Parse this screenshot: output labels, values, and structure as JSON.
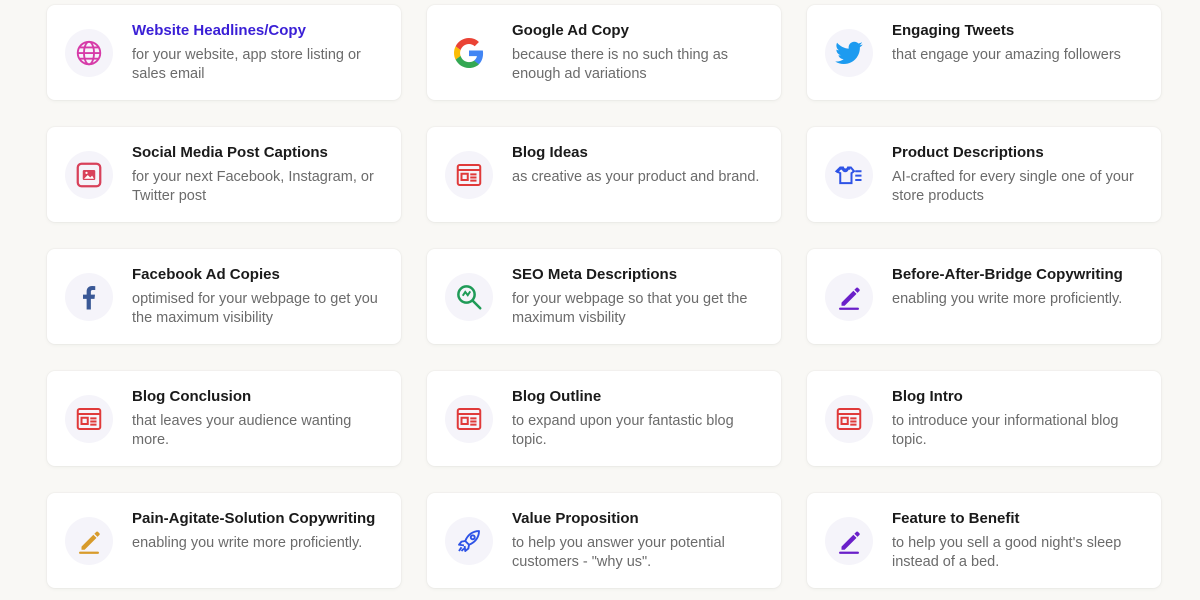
{
  "colors": {
    "active_title": "#3a1fd6",
    "title": "#1a1a1a",
    "description": "#6b6b6b",
    "card_bg": "#ffffff",
    "page_bg": "#f9f8f5"
  },
  "cards": [
    {
      "title": "Website Headlines/Copy",
      "description": "for your website, app store listing or sales email",
      "icon": "globe-icon",
      "active": true
    },
    {
      "title": "Google Ad Copy",
      "description": "because there is no such thing as enough ad variations",
      "icon": "google-icon"
    },
    {
      "title": "Engaging Tweets",
      "description": "that engage your amazing followers",
      "icon": "twitter-icon"
    },
    {
      "title": "Social Media Post Captions",
      "description": "for your next Facebook, Instagram, or Twitter post",
      "icon": "image-icon"
    },
    {
      "title": "Blog Ideas",
      "description": "as creative as your product and brand.",
      "icon": "newspaper-icon"
    },
    {
      "title": "Product Descriptions",
      "description": "AI-crafted for every single one of your store products",
      "icon": "tshirt-list-icon"
    },
    {
      "title": "Facebook Ad Copies",
      "description": "optimised for your webpage to get you the maximum visibility",
      "icon": "facebook-icon"
    },
    {
      "title": "SEO Meta Descriptions",
      "description": "for your webpage so that you get the maximum visbility",
      "icon": "search-icon"
    },
    {
      "title": "Before-After-Bridge Copywriting",
      "description": "enabling you write more proficiently.",
      "icon": "pen-icon"
    },
    {
      "title": "Blog Conclusion",
      "description": "that leaves your audience wanting more.",
      "icon": "newspaper-icon"
    },
    {
      "title": "Blog Outline",
      "description": "to expand upon your fantastic blog topic.",
      "icon": "newspaper-icon"
    },
    {
      "title": "Blog Intro",
      "description": "to introduce your informational blog topic.",
      "icon": "newspaper-icon"
    },
    {
      "title": "Pain-Agitate-Solution Copywriting",
      "description": "enabling you write more proficiently.",
      "icon": "pen-gold-icon"
    },
    {
      "title": "Value Proposition",
      "description": "to help you answer your potential customers - \"why us\".",
      "icon": "rocket-icon"
    },
    {
      "title": "Feature to Benefit",
      "description": "to help you sell a good night's sleep instead of a bed.",
      "icon": "pen-icon"
    }
  ]
}
